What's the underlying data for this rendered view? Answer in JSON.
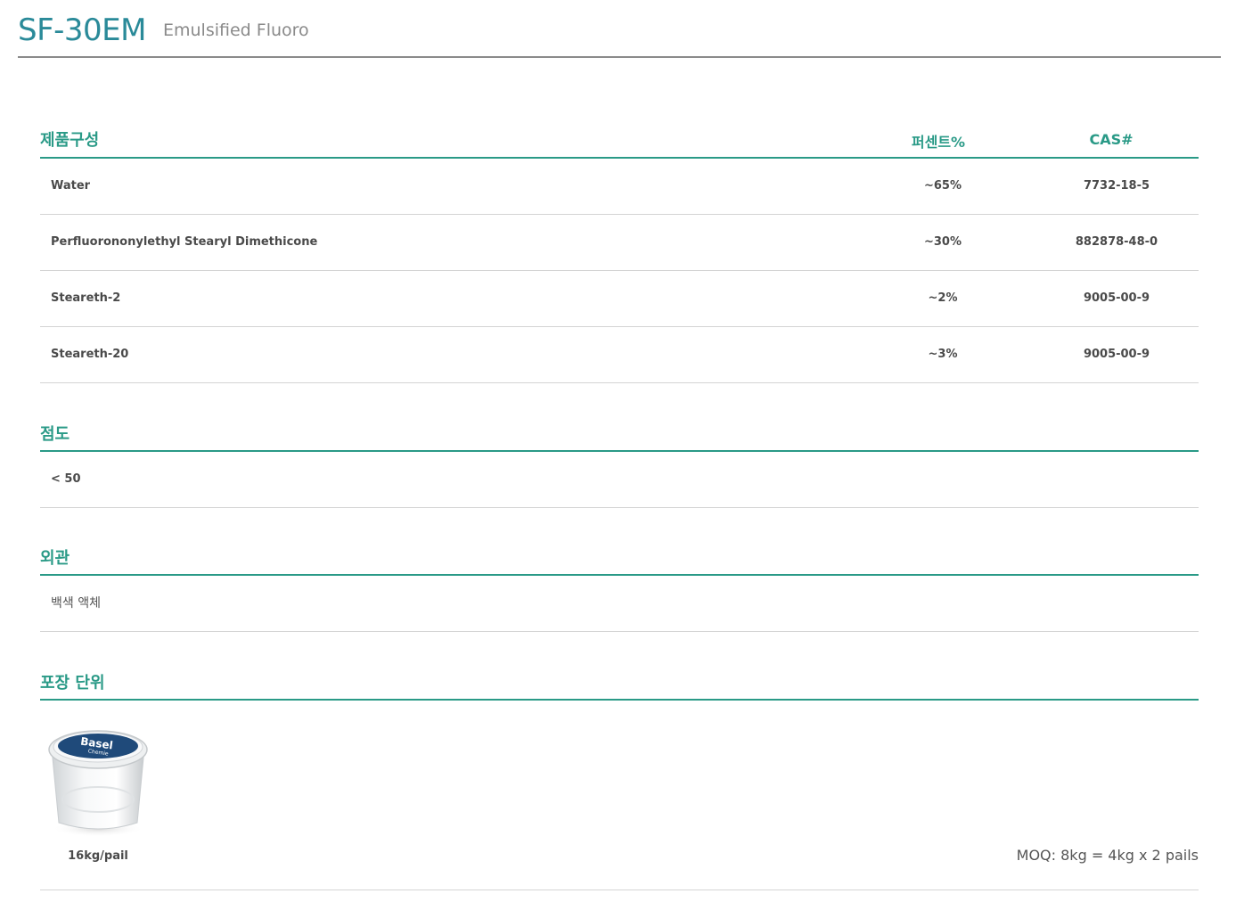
{
  "header": {
    "product_code": "SF-30EM",
    "product_name": "Emulsified Fluoro"
  },
  "composition": {
    "title": "제품구성",
    "col_percent": "퍼센트%",
    "col_cas": "CAS#",
    "rows": [
      {
        "name": "Water",
        "percent": "~65%",
        "cas": "7732-18-5"
      },
      {
        "name": "Perfluorononylethyl Stearyl Dimethicone",
        "percent": "~30%",
        "cas": "882878-48-0"
      },
      {
        "name": "Steareth-2",
        "percent": "~2%",
        "cas": "9005-00-9"
      },
      {
        "name": "Steareth-20",
        "percent": "~3%",
        "cas": "9005-00-9"
      }
    ]
  },
  "viscosity": {
    "title": "점도",
    "value": "< 50"
  },
  "appearance": {
    "title": "외관",
    "value": "백색 액체"
  },
  "packaging": {
    "title": "포장 단위",
    "pail_brand": "Basel",
    "pail_brand_sub": "Chemie",
    "unit": "16kg/pail",
    "moq": "MOQ: 8kg = 4kg x 2 pails"
  },
  "colors": {
    "accent": "#2a9a87",
    "code": "#2a8a99"
  }
}
